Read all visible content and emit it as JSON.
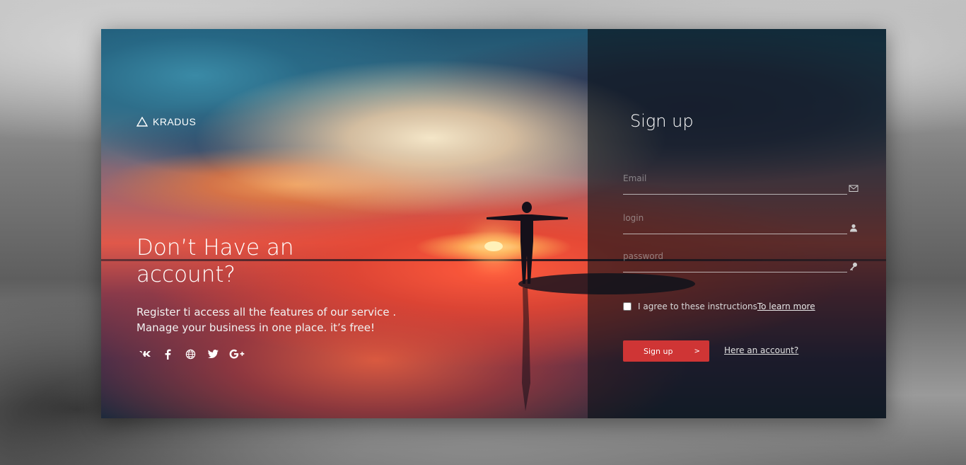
{
  "brand": {
    "name": "KRADUS",
    "icon": "triangle-logo-icon"
  },
  "hero": {
    "headline": "Don’t Have an account?",
    "subtext_line1": "Register ti access all the features of our service .",
    "subtext_line2": "Manage your business in one place. it’s free!",
    "socials": [
      {
        "name": "vk-icon",
        "glyph": "vk"
      },
      {
        "name": "facebook-icon",
        "glyph": "f"
      },
      {
        "name": "globe-icon",
        "glyph": "globe"
      },
      {
        "name": "twitter-icon",
        "glyph": "bird"
      },
      {
        "name": "google-plus-icon",
        "glyph": "G+"
      }
    ]
  },
  "form": {
    "title": "Sign up",
    "email": {
      "placeholder": "Email",
      "value": "",
      "icon": "envelope-icon"
    },
    "login": {
      "placeholder": "login",
      "value": "",
      "icon": "user-icon"
    },
    "password": {
      "placeholder": "password",
      "value": "",
      "icon": "key-icon"
    },
    "agree_text": "I agree to these instructions",
    "agree_link": "To learn more",
    "submit_label": "Sign up",
    "submit_arrow": ">",
    "account_link": "Here an account?"
  },
  "colors": {
    "accent": "#cf3535",
    "panel": "#0a1218"
  }
}
